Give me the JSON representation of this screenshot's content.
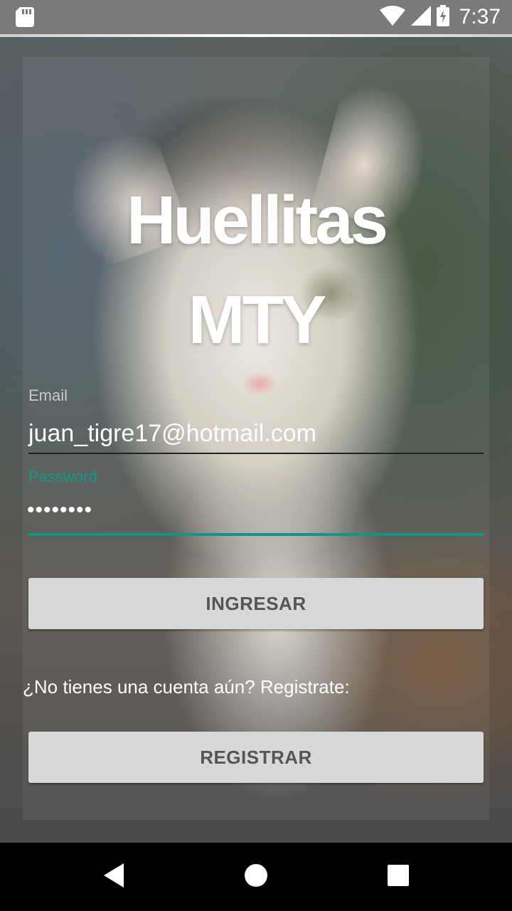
{
  "status_bar": {
    "time": "7:37",
    "icons": [
      "sd-card-icon",
      "wifi-icon",
      "cellular-signal-icon",
      "battery-charging-icon"
    ]
  },
  "logo": {
    "line1": "Huellitas",
    "line2": "MTY"
  },
  "login_form": {
    "email_label": "Email",
    "email_value": "juan_tigre17@hotmail.com",
    "password_label": "Password",
    "password_value": "••••••••",
    "login_button": "INGRESAR"
  },
  "register": {
    "prompt": "¿No tienes una cuenta aún? Registrate:",
    "button": "REGISTRAR"
  },
  "nav_bar": {
    "icons": [
      "back-icon",
      "home-icon",
      "recent-apps-icon"
    ]
  },
  "colors": {
    "accent": "#0f9688",
    "button_bg": "#d7d8d8",
    "button_text": "#555555"
  }
}
